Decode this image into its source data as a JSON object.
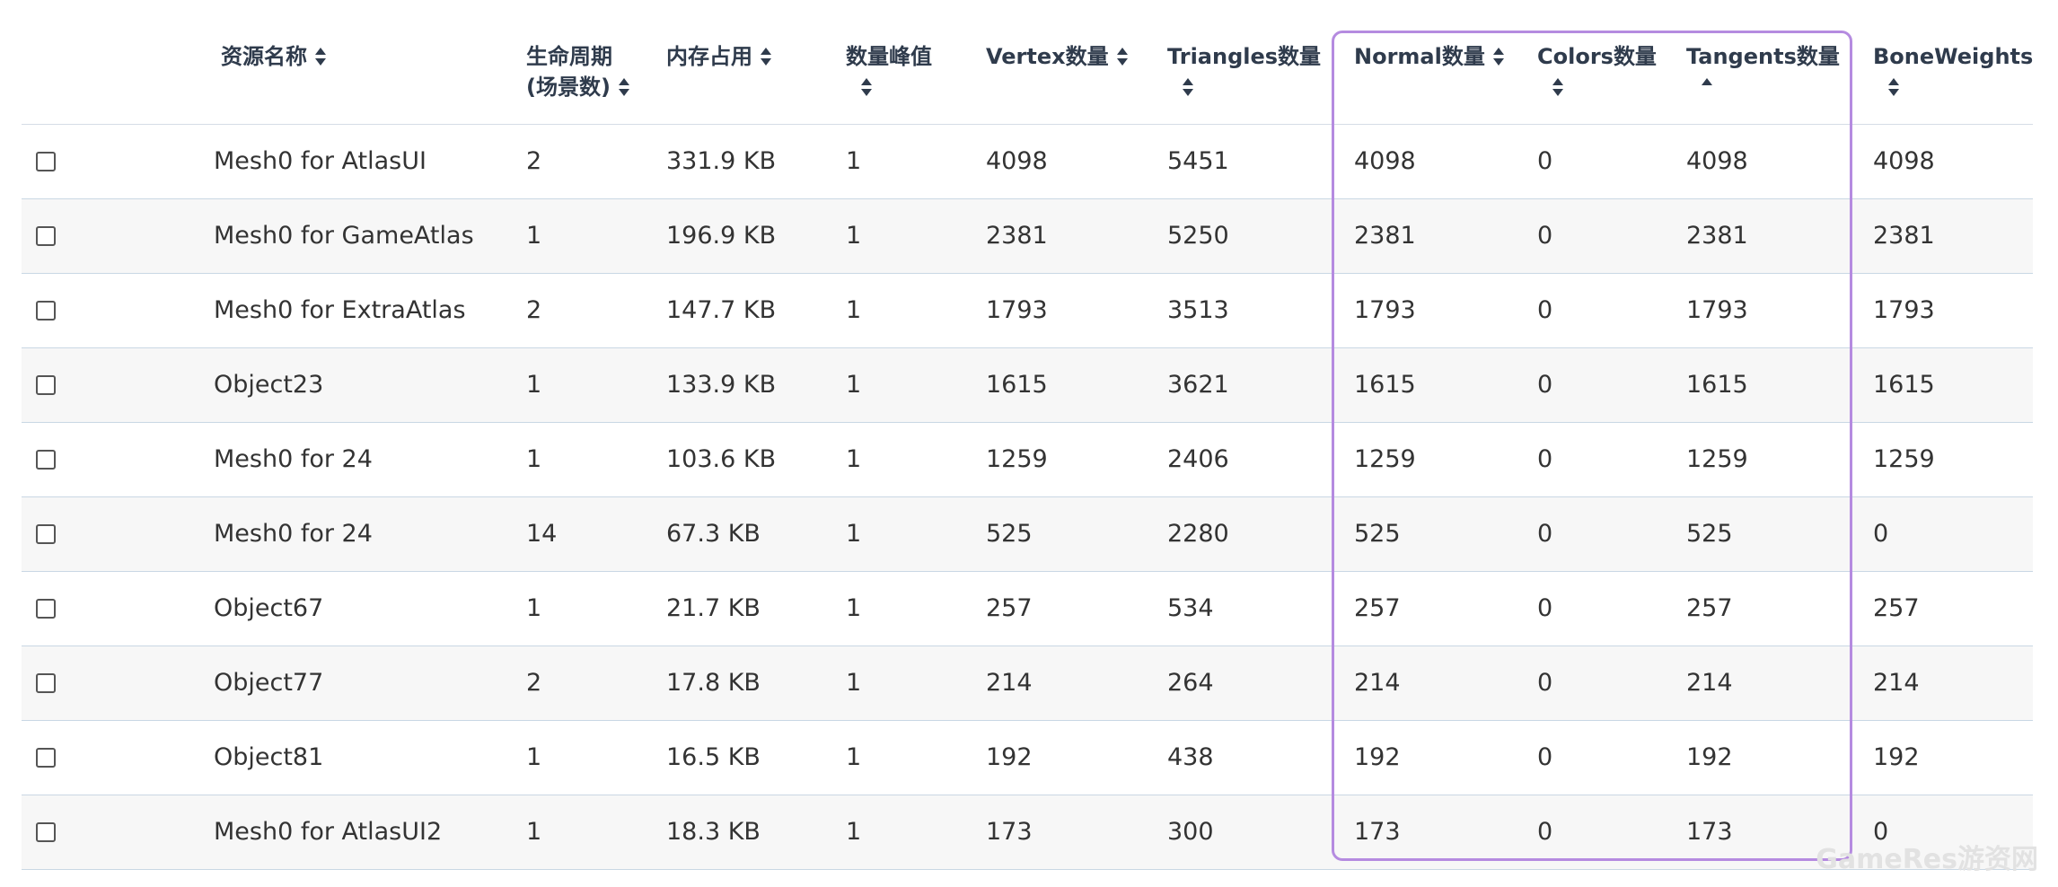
{
  "headers": {
    "name": "资源名称",
    "lifecycle_line1": "生命周期",
    "lifecycle_line2": "(场景数)",
    "memory": "内存占用",
    "peak": "数量峰值",
    "vertex": "Vertex数量",
    "triangles": "Triangles数量",
    "normal": "Normal数量",
    "colors": "Colors数量",
    "tangents": "Tangents数量",
    "boneweights": "BoneWeights"
  },
  "rows": [
    {
      "name": "Mesh0 for AtlasUI",
      "lifecycle": "2",
      "memory": "331.9 KB",
      "peak": "1",
      "vertex": "4098",
      "triangles": "5451",
      "normal": "4098",
      "colors": "0",
      "tangents": "4098",
      "boneweights": "4098"
    },
    {
      "name": "Mesh0 for GameAtlas",
      "lifecycle": "1",
      "memory": "196.9 KB",
      "peak": "1",
      "vertex": "2381",
      "triangles": "5250",
      "normal": "2381",
      "colors": "0",
      "tangents": "2381",
      "boneweights": "2381"
    },
    {
      "name": "Mesh0 for ExtraAtlas",
      "lifecycle": "2",
      "memory": "147.7 KB",
      "peak": "1",
      "vertex": "1793",
      "triangles": "3513",
      "normal": "1793",
      "colors": "0",
      "tangents": "1793",
      "boneweights": "1793"
    },
    {
      "name": "Object23",
      "lifecycle": "1",
      "memory": "133.9 KB",
      "peak": "1",
      "vertex": "1615",
      "triangles": "3621",
      "normal": "1615",
      "colors": "0",
      "tangents": "1615",
      "boneweights": "1615"
    },
    {
      "name": "Mesh0 for 24",
      "lifecycle": "1",
      "memory": "103.6 KB",
      "peak": "1",
      "vertex": "1259",
      "triangles": "2406",
      "normal": "1259",
      "colors": "0",
      "tangents": "1259",
      "boneweights": "1259"
    },
    {
      "name": "Mesh0 for 24",
      "lifecycle": "14",
      "memory": "67.3 KB",
      "peak": "1",
      "vertex": "525",
      "triangles": "2280",
      "normal": "525",
      "colors": "0",
      "tangents": "525",
      "boneweights": "0"
    },
    {
      "name": "Object67",
      "lifecycle": "1",
      "memory": "21.7 KB",
      "peak": "1",
      "vertex": "257",
      "triangles": "534",
      "normal": "257",
      "colors": "0",
      "tangents": "257",
      "boneweights": "257"
    },
    {
      "name": "Object77",
      "lifecycle": "2",
      "memory": "17.8 KB",
      "peak": "1",
      "vertex": "214",
      "triangles": "264",
      "normal": "214",
      "colors": "0",
      "tangents": "214",
      "boneweights": "214"
    },
    {
      "name": "Object81",
      "lifecycle": "1",
      "memory": "16.5 KB",
      "peak": "1",
      "vertex": "192",
      "triangles": "438",
      "normal": "192",
      "colors": "0",
      "tangents": "192",
      "boneweights": "192"
    },
    {
      "name": "Mesh0 for AtlasUI2",
      "lifecycle": "1",
      "memory": "18.3 KB",
      "peak": "1",
      "vertex": "173",
      "triangles": "300",
      "normal": "173",
      "colors": "0",
      "tangents": "173",
      "boneweights": "0"
    }
  ],
  "watermark": "GameRes游资网",
  "colors": {
    "highlight_border": "#b58be0",
    "header_text": "#2f3b4c",
    "row_alt": "#f7f7f7"
  }
}
